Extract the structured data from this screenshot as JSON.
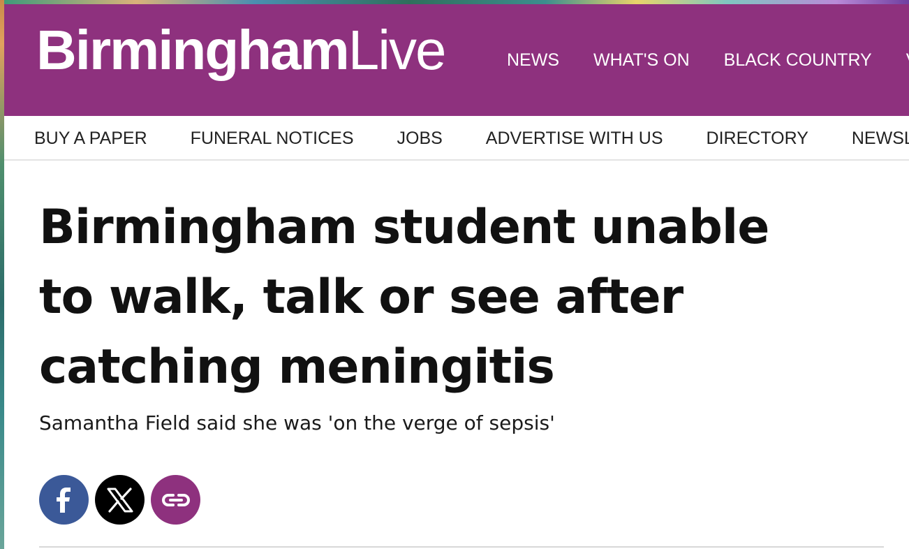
{
  "site": {
    "logo_bold": "Birmingham",
    "logo_light": "Live"
  },
  "main_nav": {
    "items": [
      "NEWS",
      "WHAT'S ON",
      "BLACK COUNTRY",
      "V"
    ]
  },
  "sub_nav": {
    "items": [
      "BUY A PAPER",
      "FUNERAL NOTICES",
      "JOBS",
      "ADVERTISE WITH US",
      "DIRECTORY",
      "NEWSLE"
    ]
  },
  "article": {
    "headline": "Birmingham student unable to walk, talk or see after catching meningitis",
    "standfirst": "Samantha Field said she was 'on the verge of sepsis'"
  },
  "share": {
    "buttons": [
      {
        "icon": "facebook-icon",
        "color": "#3b5998"
      },
      {
        "icon": "x-icon",
        "color": "#000000"
      },
      {
        "icon": "link-icon",
        "color": "#8e317e"
      }
    ]
  },
  "colors": {
    "brand": "#8e317e",
    "facebook": "#3b5998"
  }
}
